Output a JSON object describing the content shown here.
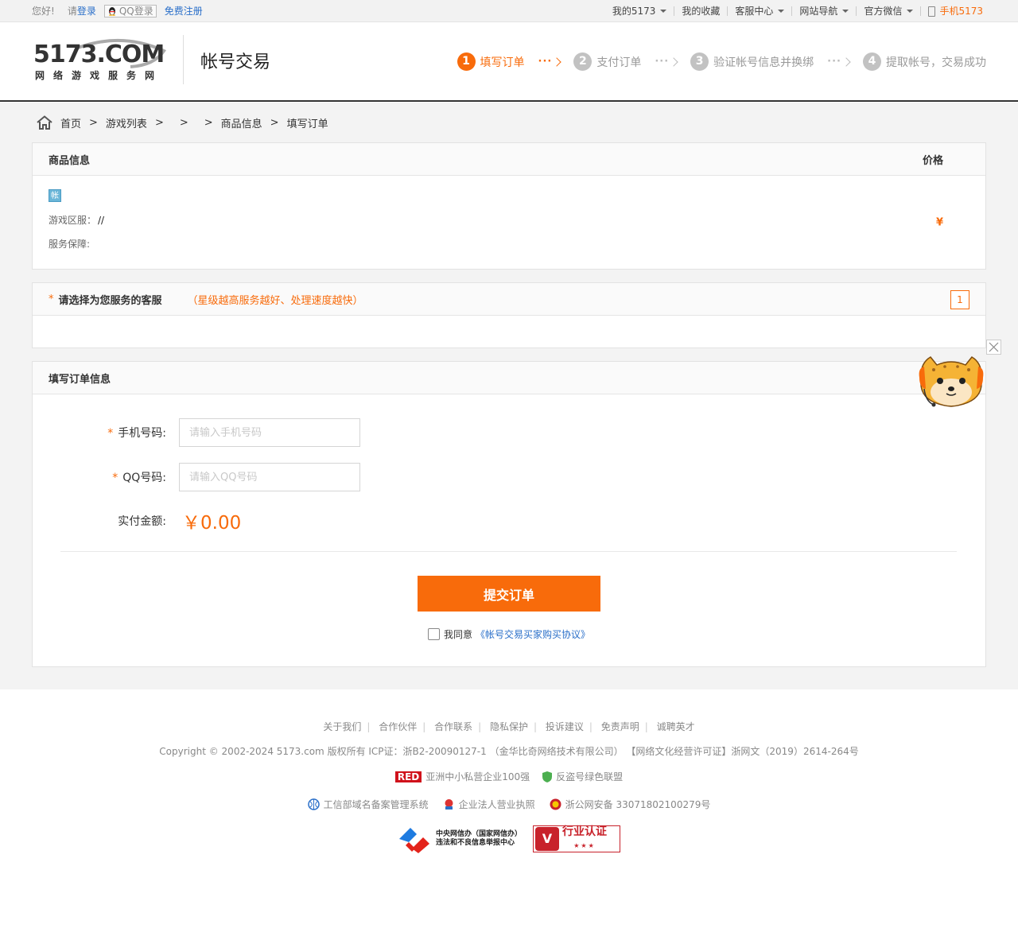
{
  "topbar": {
    "hello": "您好!",
    "login_prefix": "请",
    "login": "登录",
    "qq_login": "QQ登录",
    "register": "免费注册",
    "my5173": "我的5173",
    "favorites": "我的收藏",
    "service": "客服中心",
    "sitenav": "网站导航",
    "wechat": "官方微信",
    "mobile": "手机5173"
  },
  "header": {
    "logo_text": "5173.COM",
    "logo_sub": "网络游戏服务网",
    "title": "帐号交易",
    "steps": [
      {
        "num": "1",
        "label": "填写订单"
      },
      {
        "num": "2",
        "label": "支付订单"
      },
      {
        "num": "3",
        "label": "验证帐号信息并换绑"
      },
      {
        "num": "4",
        "label": "提取帐号，交易成功"
      }
    ],
    "step_dots": "···"
  },
  "breadcrumb": {
    "home": "首页",
    "game_list": "游戏列表",
    "goods_info": "商品信息",
    "fill_order": "填写订单",
    "sep": ">"
  },
  "goods": {
    "header": "商品信息",
    "price_header": "价格",
    "tag": "帐",
    "server_label": "游戏区服：",
    "server_value": "//",
    "guarantee_label": "服务保障:",
    "price": "¥"
  },
  "customer_service": {
    "required": "*",
    "title": "请选择为您服务的客服",
    "hint": "（星级越高服务越好、处理速度越快）",
    "count": "1"
  },
  "order_form": {
    "header": "填写订单信息",
    "phone_label": "手机号码:",
    "phone_placeholder": "请输入手机号码",
    "qq_label": "QQ号码:",
    "qq_placeholder": "请输入QQ号码",
    "amount_label": "实付金额:",
    "amount": "￥0.00",
    "submit": "提交订单",
    "agree_text": "我同意",
    "agreement_link": "《帐号交易买家购买协议》"
  },
  "footer": {
    "links": [
      "关于我们",
      "合作伙伴",
      "合作联系",
      "隐私保护",
      "投诉建议",
      "免责声明",
      "诚聘英才"
    ],
    "copyright": "Copyright © 2002-2024 5173.com 版权所有   ICP证：浙B2-20090127-1 （金华比奇网络技术有限公司）   【网络文化经营许可证】浙网文（2019）2614-264号",
    "red_badge": "RED",
    "red_text": "亚洲中小私营企业100强",
    "anti_theft": "反盗号绿色联盟",
    "miit": "工信部域名备案管理系统",
    "license": "企业法人营业执照",
    "police": "浙公网安备 33071802100279号",
    "cac_line1": "中央网信办（国家网信办）",
    "cac_line2": "违法和不良信息举报中心",
    "industry_v": "V",
    "industry_text": "行业认证",
    "industry_stars": "★★★"
  },
  "colors": {
    "accent": "#f86b0b",
    "link": "#2a6fc9",
    "background": "#f3f3f3"
  }
}
